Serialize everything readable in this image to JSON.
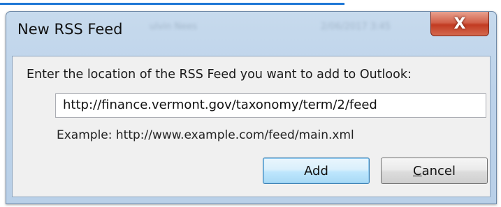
{
  "dialog": {
    "title": "New RSS Feed",
    "background_title_ghost": [
      "ulvin Nees",
      "2/06/2017 3:45"
    ],
    "close_label": "X",
    "prompt": "Enter the location of the RSS Feed you want to add to Outlook:",
    "url_value": "http://finance.vermont.gov/taxonomy/term/2/feed",
    "example_text": "Example: http://www.example.com/feed/main.xml",
    "add_label": "Add",
    "cancel_access_key": "C",
    "cancel_rest": "ancel"
  },
  "colors": {
    "accent_line": "#1f78d6",
    "close_button": "#c23b22",
    "frame": "#bdd3ea",
    "client": "#f0f0f0"
  }
}
